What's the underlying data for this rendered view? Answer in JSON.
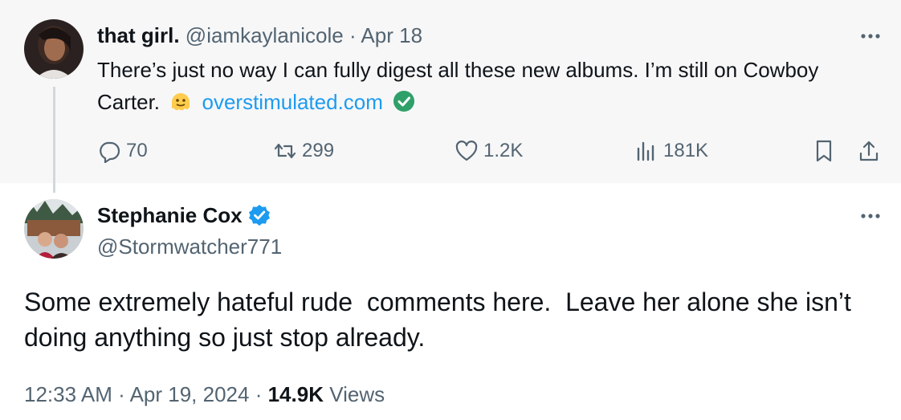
{
  "parent": {
    "author_name": "that girl.",
    "handle": "@iamkaylanicole",
    "separator": "·",
    "date": "Apr 18",
    "text": "There’s just no way I can fully digest all these new albums. I’m still on Cowboy Carter.",
    "emoji_icon": "melting-face-emoji-icon",
    "link_text": "overstimulated.com",
    "link_badge_icon": "green-check-icon",
    "actions": {
      "replies": "70",
      "reposts": "299",
      "likes": "1.2K",
      "views": "181K"
    }
  },
  "reply": {
    "author_name": "Stephanie Cox",
    "verified_icon": "blue-verified-icon",
    "handle": "@Stormwatcher771",
    "text": "Some extremely hateful rude  comments here.  Leave her alone she isn’t doing anything so just stop already.",
    "time": "12:33 AM",
    "separator": "·",
    "date": "Apr 19, 2024",
    "views_count": "14.9K",
    "views_label": "Views"
  },
  "colors": {
    "accent": "#1d9bf0",
    "muted": "#536471",
    "text": "#0f1419",
    "parent_bg": "#f7f7f8",
    "thread_line": "#cfd9de",
    "link_check": "#2fa069"
  }
}
